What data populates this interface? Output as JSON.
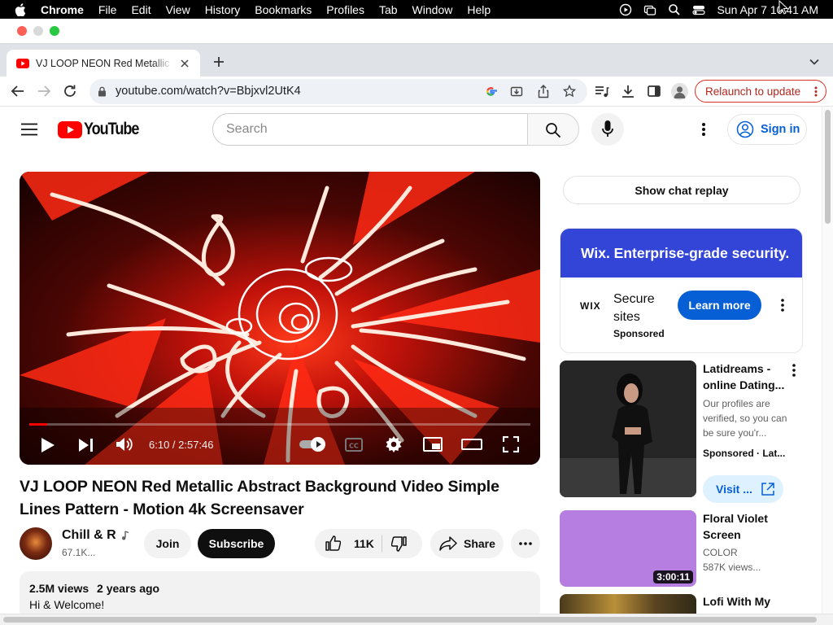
{
  "menubar": {
    "app": "Chrome",
    "items": [
      "File",
      "Edit",
      "View",
      "History",
      "Bookmarks",
      "Profiles",
      "Tab",
      "Window",
      "Help"
    ],
    "datetime": "Sun Apr 7  10:41 AM"
  },
  "tab": {
    "title": "VJ LOOP NEON Red Metallic Abstract Background Video Simple Lines Pattern"
  },
  "toolbar": {
    "url": "youtube.com/watch?v=Bbjxvl2UtK4",
    "relaunch": "Relaunch to update"
  },
  "youtube": {
    "logo_text": "YouTube",
    "search_placeholder": "Search",
    "signin": "Sign in"
  },
  "player": {
    "time": "6:10 / 2:57:46",
    "progress": 0.035
  },
  "video": {
    "title": "VJ LOOP NEON Red Metallic Abstract Background Video Simple Lines Pattern - Motion 4k Screensaver",
    "channel": "Chill & R",
    "subs": "67.1K...",
    "join": "Join",
    "subscribe": "Subscribe",
    "likes": "11K",
    "share": "Share",
    "views": "2.5M views",
    "age": "2 years ago",
    "desc": "Hi & Welcome!"
  },
  "sidebar": {
    "chat_replay": "Show chat replay",
    "ad": {
      "banner": "Wix. Enterprise-grade security.",
      "logo": "WIX",
      "text": "Secure sites",
      "sponsored": "Sponsored",
      "cta": "Learn more"
    },
    "items": [
      {
        "title": "Latidreams - online Dating...",
        "desc": "Our profiles are verified, so you can be sure you'r...",
        "meta": "Sponsored · Lat...",
        "cta": "Visit ..."
      },
      {
        "title": "Floral Violet Screen",
        "channel": "COLOR",
        "views": "587K views...",
        "duration": "3:00:11"
      },
      {
        "title": "Lofi With My"
      }
    ]
  },
  "colors": {
    "accent_red": "#ff0000",
    "link_blue": "#065fd4",
    "wix_blue": "#3345d6",
    "thumb_violet": "#b57ee0"
  }
}
